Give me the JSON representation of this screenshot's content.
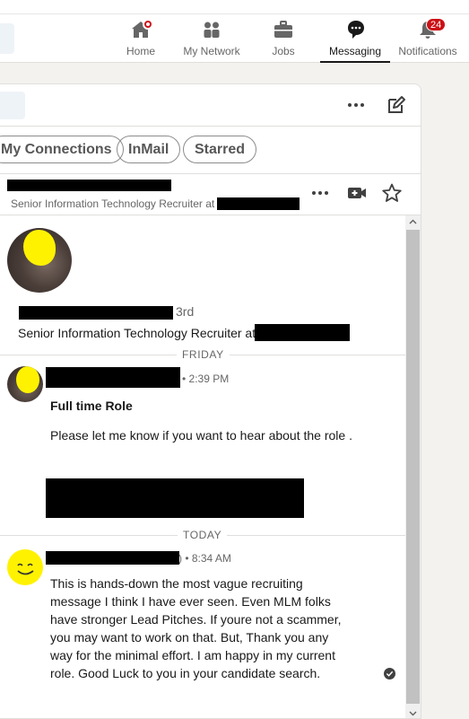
{
  "nav": {
    "items": [
      {
        "label": "Home",
        "icon": "home-icon"
      },
      {
        "label": "My Network",
        "icon": "network-icon"
      },
      {
        "label": "Jobs",
        "icon": "briefcase-icon"
      },
      {
        "label": "Messaging",
        "icon": "messaging-icon"
      },
      {
        "label": "Notifications",
        "icon": "bell-icon"
      }
    ],
    "notifications_count": "24"
  },
  "filters": [
    "My Connections",
    "InMail",
    "Starred"
  ],
  "conversation": {
    "header_subtitle": "Senior Information Technology Recruiter at",
    "profile_degree": "3rd",
    "profile_headline": "Senior Information Technology Recruiter at"
  },
  "thread": {
    "day1": "FRIDAY",
    "msg1_time": "• 2:39 PM",
    "msg1_subject": "Full time Role",
    "msg1_body": "Please let me know if you want to hear about the role .",
    "day2": "TODAY",
    "msg2_time": ") • 8:34 AM",
    "msg2_body": "This is hands-down the most vague recruiting message I think I have ever seen.  Even MLM folks have stronger Lead Pitches.  If youre not a scammer, you may want to work on that.  But, Thank you any way for the minimal effort. I am happy in my current role. Good Luck to you in your candidate search."
  },
  "colors": {
    "accent": "#cc1016",
    "highlight": "#fff200",
    "redaction": "#000000"
  }
}
